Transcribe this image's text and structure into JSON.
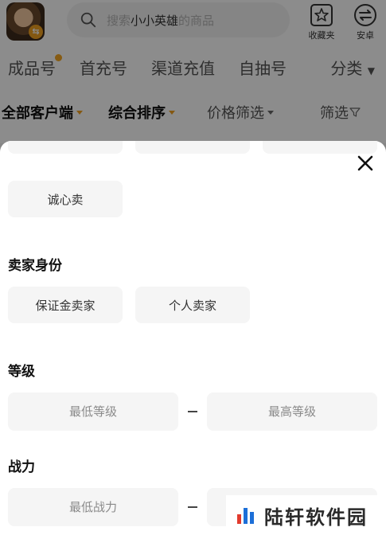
{
  "header": {
    "search_placeholder_prefix": "搜索",
    "search_game": "小小英雄",
    "search_placeholder_suffix": "的商品",
    "favorites_label": "收藏夹",
    "android_label": "安卓"
  },
  "tabs": [
    "成品号",
    "首充号",
    "渠道充值",
    "自抽号"
  ],
  "category_label": "分类",
  "filters": {
    "client": "全部客户端",
    "sort": "综合排序",
    "price": "价格筛选",
    "filter": "筛选"
  },
  "sheet": {
    "sale_type_option": "诚心卖",
    "seller_identity_title": "卖家身份",
    "seller_options": [
      "保证金卖家",
      "个人卖家"
    ],
    "level_title": "等级",
    "level_min_placeholder": "最低等级",
    "level_max_placeholder": "最高等级",
    "power_title": "战力",
    "power_min_placeholder": "最低战力",
    "power_max_placeholder": ""
  },
  "watermark": {
    "text": "陆轩软件园"
  },
  "colors": {
    "accent": "#f0a020",
    "chip_bg": "#f5f5f5",
    "mask": "rgba(0,0,0,0.45)"
  },
  "icons": {
    "search": "search-icon",
    "favorites": "star-box-icon",
    "android": "swap-circle-icon",
    "close": "close-icon",
    "filter": "filter-icon",
    "watermark_logo": "bar-chart-logo"
  }
}
